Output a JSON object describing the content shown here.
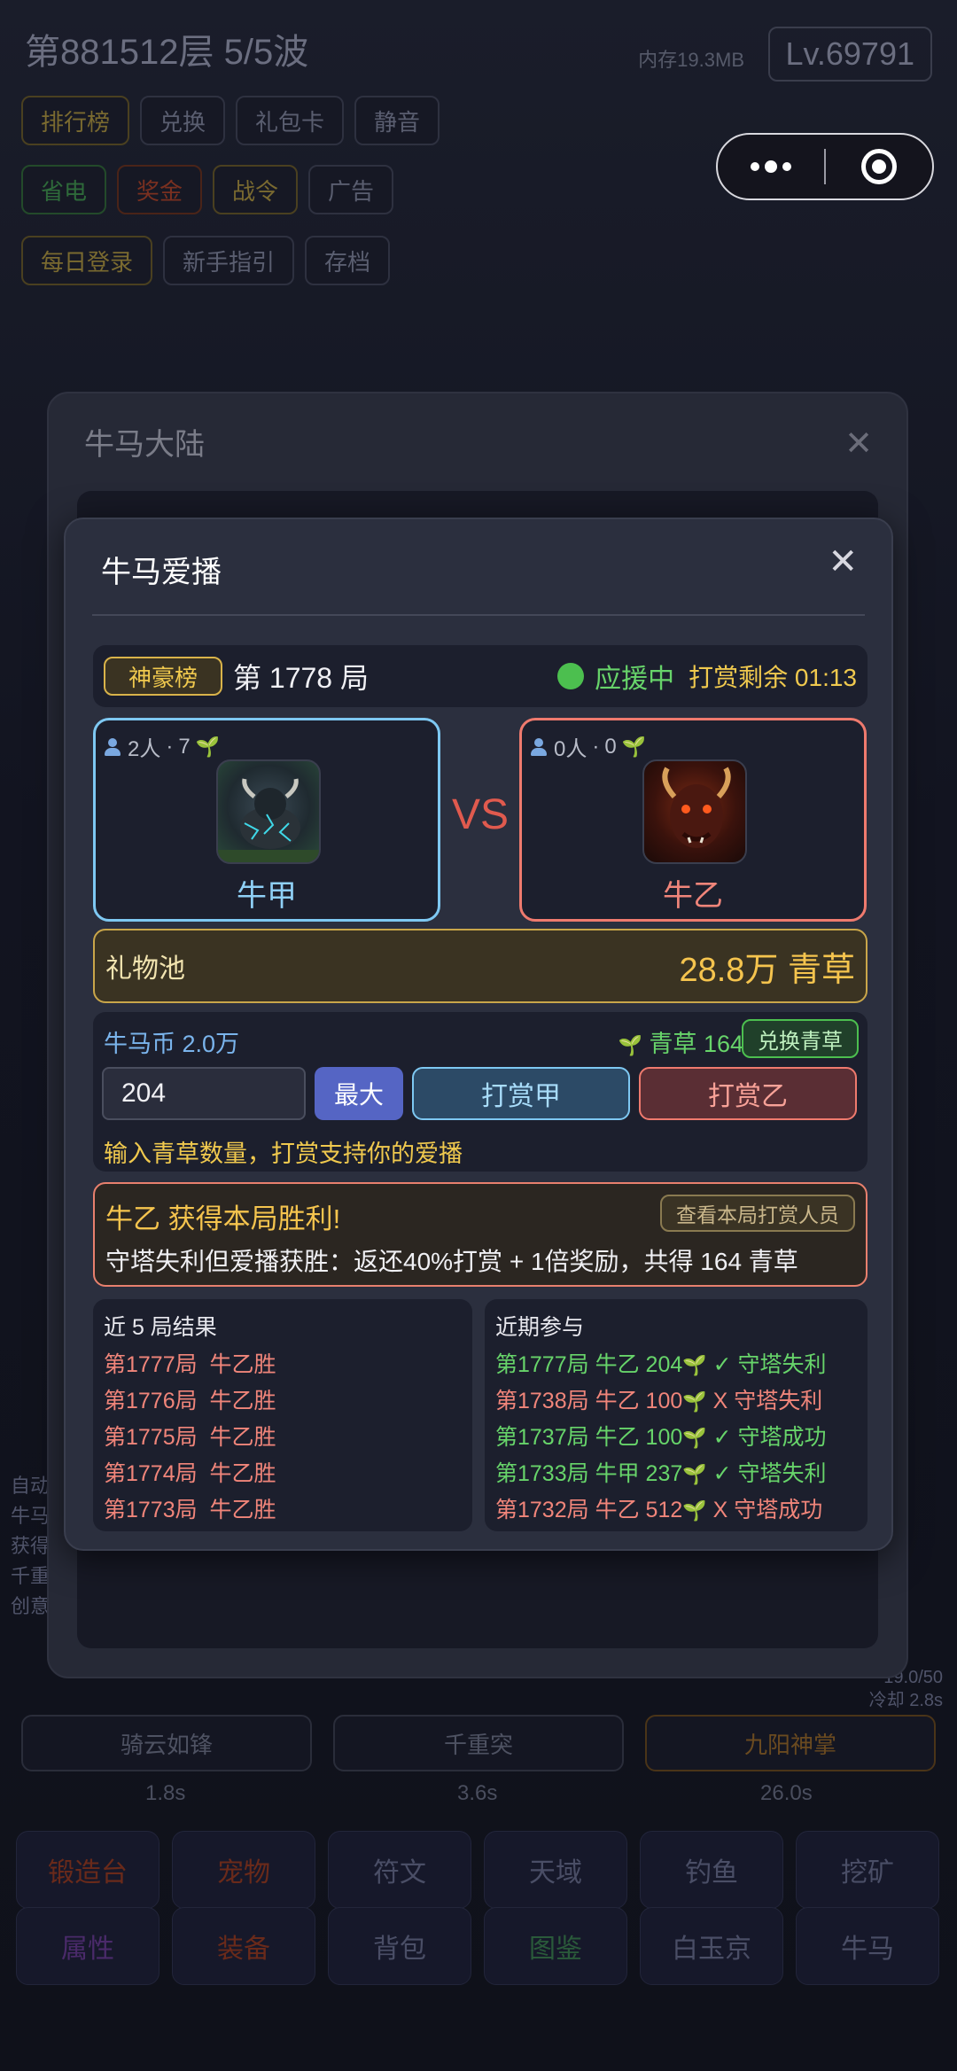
{
  "background": {
    "floor": "第881512层  5/5波",
    "memory": "内存19.3MB",
    "level": "Lv.69791",
    "row1": [
      "排行榜",
      "兑换",
      "礼包卡",
      "静音"
    ],
    "row2": [
      "省电",
      "奖金",
      "战令",
      "广告"
    ],
    "row3": [
      "每日登录",
      "新手指引",
      "存档"
    ],
    "skills": [
      "骑云如锋",
      "千重突",
      "九阳神掌"
    ],
    "skill_times": [
      "1.8s",
      "3.6s",
      "26.0s"
    ],
    "right_stat": [
      "19.0/50",
      "冷却 2.8s"
    ],
    "side_text": [
      "自动",
      "牛马",
      "获得",
      "千重",
      "创意"
    ],
    "nav_row1": [
      "锻造台",
      "宠物",
      "符文",
      "天域",
      "钓鱼",
      "挖矿"
    ],
    "nav_row2": [
      "属性",
      "装备",
      "背包",
      "图鉴",
      "白玉京",
      "牛马"
    ]
  },
  "outer_panel": {
    "title": "牛马大陆",
    "close": "✕"
  },
  "modal": {
    "title": "牛马爱播",
    "close": "✕",
    "rank_badge": "神豪榜",
    "round": "第 1778 局",
    "status": "应援中",
    "countdown": "打赏剩余 01:13",
    "team_a": {
      "people": "2人",
      "sep": "·",
      "grass": "7",
      "name": "牛甲"
    },
    "team_b": {
      "people": "0人",
      "sep": "·",
      "grass": "0",
      "name": "牛乙"
    },
    "vs": "VS",
    "gift_pool_label": "礼物池",
    "gift_pool_value": "28.8万 青草",
    "coins": "牛马币 2.0万",
    "grass": "青草 164",
    "exchange_button": "兑换青草",
    "amount_value": "204",
    "max_button": "最大",
    "tip_a_button": "打赏甲",
    "tip_b_button": "打赏乙",
    "tip_hint": "输入青草数量，打赏支持你的爱播",
    "result_title": "牛乙 获得本局胜利!",
    "view_tippers_button": "查看本局打赏人员",
    "result_desc": "守塔失利但爱播获胜：返还40%打赏 + 1倍奖励，共得 164 青草",
    "recent_title": "近 5 局结果",
    "recent": [
      {
        "round": "第1777局",
        "winner": "牛乙胜"
      },
      {
        "round": "第1776局",
        "winner": "牛乙胜"
      },
      {
        "round": "第1775局",
        "winner": "牛乙胜"
      },
      {
        "round": "第1774局",
        "winner": "牛乙胜"
      },
      {
        "round": "第1773局",
        "winner": "牛乙胜"
      }
    ],
    "participation_title": "近期参与",
    "participation": [
      {
        "round": "第1777局",
        "team": "牛乙",
        "amount": "204",
        "mark": "✓",
        "outcome": "守塔失利",
        "color": "green"
      },
      {
        "round": "第1738局",
        "team": "牛乙",
        "amount": "100",
        "mark": "X",
        "outcome": "守塔失利",
        "color": "red"
      },
      {
        "round": "第1737局",
        "team": "牛乙",
        "amount": "100",
        "mark": "✓",
        "outcome": "守塔成功",
        "color": "green"
      },
      {
        "round": "第1733局",
        "team": "牛甲",
        "amount": "237",
        "mark": "✓",
        "outcome": "守塔失利",
        "color": "green"
      },
      {
        "round": "第1732局",
        "team": "牛乙",
        "amount": "512",
        "mark": "X",
        "outcome": "守塔成功",
        "color": "red"
      }
    ]
  }
}
